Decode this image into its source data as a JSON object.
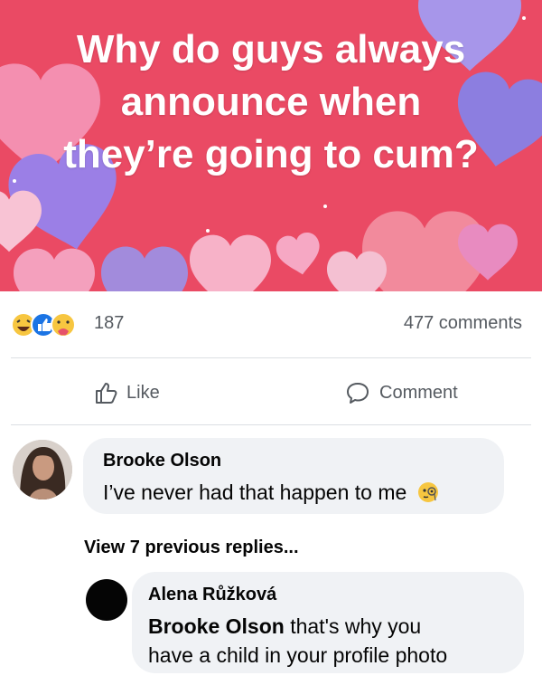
{
  "post": {
    "banner_lines": [
      "Why do guys always",
      "announce when",
      "they’re going to cum?"
    ],
    "banner_color": "#ea4a64"
  },
  "stats": {
    "reaction_icons": [
      "haha-icon",
      "like-icon",
      "care-icon"
    ],
    "reaction_count": "187",
    "comments_label": "477 comments"
  },
  "actions": {
    "like_label": "Like",
    "comment_label": "Comment"
  },
  "comments": [
    {
      "author": "Brooke Olson",
      "text": "I’ve never had that happen to me",
      "emoji": "monocle-face-icon"
    }
  ],
  "view_replies_label": "View 7 previous replies...",
  "reply": {
    "author": "Alena Růžková",
    "mention": "Brooke Olson",
    "text_line1": "that's why you",
    "text_line2": "have a child in your profile photo"
  }
}
